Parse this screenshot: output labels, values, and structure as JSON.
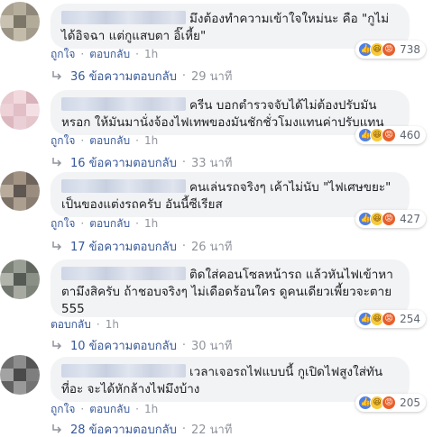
{
  "comments": [
    {
      "text_line1": "มึงต้องทำความเข้าใจใหม่นะ คือ \"กูไม่",
      "text_line2": "ได้อิจฉา แต่กูแสบตา อิ๊เหี้ย\"",
      "text_line3": "",
      "reaction_count": "738",
      "like_label": "ถูกใจ",
      "reply_label": "ตอบกลับ",
      "time": "1h",
      "replies_label": "36 ข้อความตอบกลับ",
      "replies_time": "29 นาที",
      "reactions": [
        "like-icon",
        "haha-icon",
        "angry-icon"
      ],
      "avatar_colors": [
        "#a9a18f",
        "#b5ae9c",
        "#8f887a",
        "#c9c2b2",
        "#7c7668",
        "#b3ab99",
        "#9b9484",
        "#c3bcaa",
        "#a39c8c"
      ]
    },
    {
      "text_line1": "ครีน บอกตำรวจจับได้ไม่ต้องปรับมัน",
      "text_line2": "หรอก ให้มันมานั่งจ้องไฟเทพของมันชักชั่วโมงแทนค่าปรับแทน",
      "text_line3": "",
      "reaction_count": "460",
      "like_label": "ถูกใจ",
      "reply_label": "ตอบกลับ",
      "time": "1h",
      "replies_label": "16 ข้อความตอบกลับ",
      "replies_time": "33 นาที",
      "reactions": [
        "like-icon",
        "haha-icon",
        "angry-icon"
      ],
      "avatar_colors": [
        "#e7c9cf",
        "#f1d9de",
        "#d8b3bb",
        "#edd2d8",
        "#e2bec6",
        "#f4e0e4",
        "#dcb7c0",
        "#ead0d6",
        "#e5c6cd"
      ]
    },
    {
      "text_line1": "คนเล่นรถจริงๆ เค้าไม่นับ \"ไฟเศษขยะ\"",
      "text_line2": "เป็นของแต่งรถครับ อันนี้ซีเรียส",
      "text_line3": "",
      "reaction_count": "427",
      "like_label": "ถูกใจ",
      "reply_label": "ตอบกลับ",
      "time": "1h",
      "replies_label": "17 ข้อความตอบกลับ",
      "replies_time": "26 นาที",
      "reactions": [
        "like-icon",
        "haha-icon",
        "angry-icon"
      ],
      "avatar_colors": [
        "#8c7f74",
        "#a39383",
        "#6e645c",
        "#b9ab9b",
        "#5e5650",
        "#9a8c7e",
        "#7d7268",
        "#ad9f90",
        "#8a7e73"
      ]
    },
    {
      "text_line1": "ติดใส่คอนโซลหน้ารถ แล้วหันไฟเข้าหา",
      "text_line2": "ตามึงสิครับ ถ้าชอบจริงๆ ไม่เดือดร้อนใคร ดูคนเดียวเพี้ยวจะตาย",
      "text_line3": "555",
      "reaction_count": "254",
      "like_label": "ตอบกลับ",
      "reply_label": "",
      "time": "1h",
      "replies_label": "10 ข้อความตอบกลับ",
      "replies_time": "30 นาที",
      "reactions": [
        "like-icon",
        "haha-icon",
        "angry-icon"
      ],
      "avatar_colors": [
        "#7c8178",
        "#9a9f95",
        "#626760",
        "#b0b4aa",
        "#565a54",
        "#8b9087",
        "#71766e",
        "#a6aaa0",
        "#7f847b"
      ]
    },
    {
      "text_line1": "เวลาเจอรถไฟแบบนี้ กูเปิดไฟสูงใส่ทัน",
      "text_line2": "ที่อะ จะได้หักล้างไฟมึงบ้าง",
      "text_line3": "",
      "reaction_count": "205",
      "like_label": "ถูกใจ",
      "reply_label": "ตอบกลับ",
      "time": "1h",
      "replies_label": "28 ข้อความตอบกลับ",
      "replies_time": "22 นาที",
      "reactions": [
        "like-icon",
        "haha-icon",
        "angry-icon"
      ],
      "avatar_colors": [
        "#6f6f6f",
        "#8d8d8d",
        "#555555",
        "#a3a3a3",
        "#4a4a4a",
        "#7e7e7e",
        "#626262",
        "#999999",
        "#737373"
      ]
    }
  ]
}
